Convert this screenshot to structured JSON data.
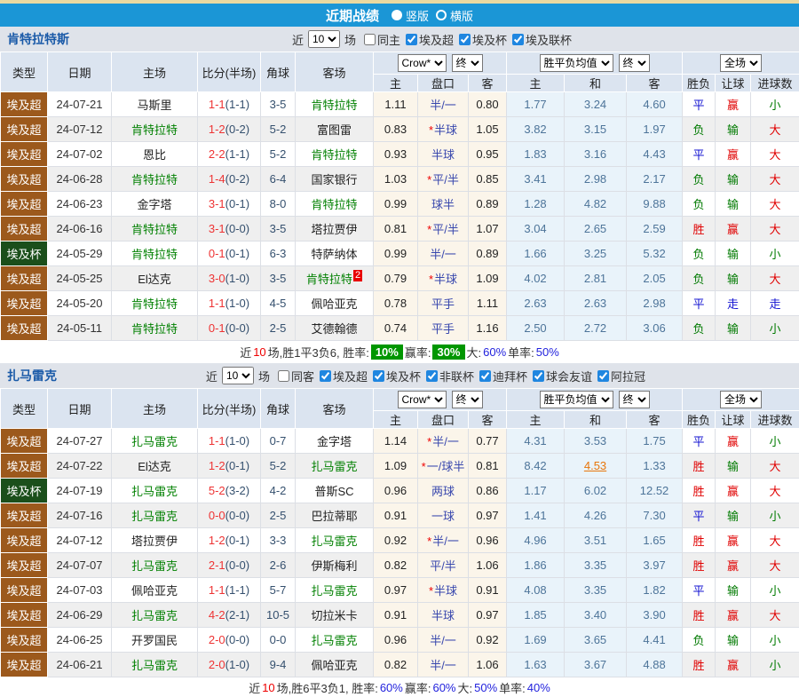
{
  "top_bar": {
    "title": "近期战绩",
    "options": [
      {
        "label": "竖版",
        "selected": true
      },
      {
        "label": "横版",
        "selected": false
      }
    ]
  },
  "columns": {
    "type": "类型",
    "date": "日期",
    "home": "主场",
    "score": "比分(半场)",
    "corner": "角球",
    "away": "客场",
    "h": "主",
    "handicap": "盘口",
    "a": "客",
    "avg_h": "主",
    "avg_d": "和",
    "avg_a": "客",
    "result": "胜负",
    "let_ball": "让球",
    "goals": "进球数"
  },
  "selectors": {
    "bookmaker": "Crow*",
    "time1": "终",
    "avg": "胜平负均值",
    "time2": "终",
    "scope": "全场"
  },
  "type_colors": {
    "埃及超": "#9c591c",
    "埃及杯": "#1b4f1b"
  },
  "value_colors": {
    "胜": "#e00000",
    "平": "#1414d2",
    "负": "#007a00",
    "赢": "#e00000",
    "走": "#1414d2",
    "输": "#007a00",
    "大": "#e00000",
    "小": "#007a00"
  },
  "sections": [
    {
      "team": "肯特拉特斯",
      "filter": {
        "recent": "近",
        "count": "10",
        "unit": "场",
        "venue": {
          "label": "同主",
          "checked": false
        },
        "competitions": [
          {
            "label": "埃及超",
            "checked": true
          },
          {
            "label": "埃及杯",
            "checked": true
          },
          {
            "label": "埃及联杯",
            "checked": true
          }
        ]
      },
      "rows": [
        {
          "type": "埃及超",
          "date": "24-07-21",
          "home": "马斯里",
          "home_green": false,
          "score": "1-1",
          "half": "(1-1)",
          "corner": "3-5",
          "away": "肯特拉特",
          "away_green": true,
          "h": "1.11",
          "star": false,
          "hcp": "半/一",
          "a": "0.80",
          "avg_h": "1.77",
          "avg_d": "3.24",
          "avg_a": "4.60",
          "res": "平",
          "hcp_res": "赢",
          "goal": "小"
        },
        {
          "type": "埃及超",
          "date": "24-07-12",
          "home": "肯特拉特",
          "home_green": true,
          "score": "1-2",
          "half": "(0-2)",
          "corner": "5-2",
          "away": "富图雷",
          "away_green": false,
          "h": "0.83",
          "star": true,
          "hcp": "半球",
          "a": "1.05",
          "avg_h": "3.82",
          "avg_d": "3.15",
          "avg_a": "1.97",
          "res": "负",
          "hcp_res": "输",
          "goal": "大"
        },
        {
          "type": "埃及超",
          "date": "24-07-02",
          "home": "恩比",
          "home_green": false,
          "score": "2-2",
          "half": "(1-1)",
          "corner": "5-2",
          "away": "肯特拉特",
          "away_green": true,
          "h": "0.93",
          "star": false,
          "hcp": "半球",
          "a": "0.95",
          "avg_h": "1.83",
          "avg_d": "3.16",
          "avg_a": "4.43",
          "res": "平",
          "hcp_res": "赢",
          "goal": "大"
        },
        {
          "type": "埃及超",
          "date": "24-06-28",
          "home": "肯特拉特",
          "home_green": true,
          "score": "1-4",
          "half": "(0-2)",
          "corner": "6-4",
          "away": "国家银行",
          "away_green": false,
          "h": "1.03",
          "star": true,
          "hcp": "平/半",
          "a": "0.85",
          "avg_h": "3.41",
          "avg_d": "2.98",
          "avg_a": "2.17",
          "res": "负",
          "hcp_res": "输",
          "goal": "大"
        },
        {
          "type": "埃及超",
          "date": "24-06-23",
          "home": "金字塔",
          "home_green": false,
          "score": "3-1",
          "half": "(0-1)",
          "corner": "8-0",
          "away": "肯特拉特",
          "away_green": true,
          "h": "0.99",
          "star": false,
          "hcp": "球半",
          "a": "0.89",
          "avg_h": "1.28",
          "avg_d": "4.82",
          "avg_a": "9.88",
          "res": "负",
          "hcp_res": "输",
          "goal": "大"
        },
        {
          "type": "埃及超",
          "date": "24-06-16",
          "home": "肯特拉特",
          "home_green": true,
          "score": "3-1",
          "half": "(0-0)",
          "corner": "3-5",
          "away": "塔拉贾伊",
          "away_green": false,
          "h": "0.81",
          "star": true,
          "hcp": "平/半",
          "a": "1.07",
          "avg_h": "3.04",
          "avg_d": "2.65",
          "avg_a": "2.59",
          "res": "胜",
          "hcp_res": "赢",
          "goal": "大"
        },
        {
          "type": "埃及杯",
          "date": "24-05-29",
          "home": "肯特拉特",
          "home_green": true,
          "score": "0-1",
          "half": "(0-1)",
          "corner": "6-3",
          "away": "特萨纳体",
          "away_green": false,
          "h": "0.99",
          "star": false,
          "hcp": "半/一",
          "a": "0.89",
          "avg_h": "1.66",
          "avg_d": "3.25",
          "avg_a": "5.32",
          "res": "负",
          "hcp_res": "输",
          "goal": "小"
        },
        {
          "type": "埃及超",
          "date": "24-05-25",
          "home": "El达克",
          "home_green": false,
          "score": "3-0",
          "half": "(1-0)",
          "corner": "3-5",
          "away": "肯特拉特",
          "away_green": true,
          "badge": "2",
          "h": "0.79",
          "star": true,
          "hcp": "半球",
          "a": "1.09",
          "avg_h": "4.02",
          "avg_d": "2.81",
          "avg_a": "2.05",
          "res": "负",
          "hcp_res": "输",
          "goal": "大"
        },
        {
          "type": "埃及超",
          "date": "24-05-20",
          "home": "肯特拉特",
          "home_green": true,
          "score": "1-1",
          "half": "(1-0)",
          "corner": "4-5",
          "away": "佩哈亚克",
          "away_green": false,
          "h": "0.78",
          "star": false,
          "hcp": "平手",
          "a": "1.11",
          "avg_h": "2.63",
          "avg_d": "2.63",
          "avg_a": "2.98",
          "res": "平",
          "hcp_res": "走",
          "goal": "走"
        },
        {
          "type": "埃及超",
          "date": "24-05-11",
          "home": "肯特拉特",
          "home_green": true,
          "score": "0-1",
          "half": "(0-0)",
          "corner": "2-5",
          "away": "艾德翰德",
          "away_green": false,
          "h": "0.74",
          "star": false,
          "hcp": "平手",
          "a": "1.16",
          "avg_h": "2.50",
          "avg_d": "2.72",
          "avg_a": "3.06",
          "res": "负",
          "hcp_res": "输",
          "goal": "小"
        }
      ],
      "summary": [
        {
          "text": "近"
        },
        {
          "text": "10",
          "color": "red"
        },
        {
          "text": "场,胜1平3负6, 胜率: "
        },
        {
          "text": "10%",
          "badge": true
        },
        {
          "text": " 赢率: "
        },
        {
          "text": "30%",
          "badge": true
        },
        {
          "text": " 大:"
        },
        {
          "text": "60%",
          "color": "blue"
        },
        {
          "text": " 单率:"
        },
        {
          "text": "50%",
          "color": "blue"
        }
      ]
    },
    {
      "team": "扎马雷克",
      "filter": {
        "recent": "近",
        "count": "10",
        "unit": "场",
        "venue": {
          "label": "同客",
          "checked": false
        },
        "competitions": [
          {
            "label": "埃及超",
            "checked": true
          },
          {
            "label": "埃及杯",
            "checked": true
          },
          {
            "label": "非联杯",
            "checked": true
          },
          {
            "label": "迪拜杯",
            "checked": true
          },
          {
            "label": "球会友谊",
            "checked": true
          },
          {
            "label": "阿拉冠",
            "checked": true
          }
        ]
      },
      "rows": [
        {
          "type": "埃及超",
          "date": "24-07-27",
          "home": "扎马雷克",
          "home_green": true,
          "score": "1-1",
          "half": "(1-0)",
          "corner": "0-7",
          "away": "金字塔",
          "away_green": false,
          "h": "1.14",
          "star": true,
          "hcp": "半/一",
          "a": "0.77",
          "avg_h": "4.31",
          "avg_d": "3.53",
          "avg_a": "1.75",
          "res": "平",
          "hcp_res": "赢",
          "goal": "小"
        },
        {
          "type": "埃及超",
          "date": "24-07-22",
          "home": "El达克",
          "home_green": false,
          "score": "1-2",
          "half": "(0-1)",
          "corner": "5-2",
          "away": "扎马雷克",
          "away_green": true,
          "h": "1.09",
          "star": true,
          "hcp": "一/球半",
          "a": "0.81",
          "avg_h": "8.42",
          "avg_d": "4.53",
          "avg_d_hl": true,
          "avg_a": "1.33",
          "res": "胜",
          "hcp_res": "输",
          "goal": "大"
        },
        {
          "type": "埃及杯",
          "date": "24-07-19",
          "home": "扎马雷克",
          "home_green": true,
          "score": "5-2",
          "half": "(3-2)",
          "corner": "4-2",
          "away": "普斯SC",
          "away_green": false,
          "h": "0.96",
          "star": false,
          "hcp": "两球",
          "a": "0.86",
          "avg_h": "1.17",
          "avg_d": "6.02",
          "avg_a": "12.52",
          "res": "胜",
          "hcp_res": "赢",
          "goal": "大"
        },
        {
          "type": "埃及超",
          "date": "24-07-16",
          "home": "扎马雷克",
          "home_green": true,
          "score": "0-0",
          "half": "(0-0)",
          "corner": "2-5",
          "away": "巴拉蒂耶",
          "away_green": false,
          "h": "0.91",
          "star": false,
          "hcp": "一球",
          "a": "0.97",
          "avg_h": "1.41",
          "avg_d": "4.26",
          "avg_a": "7.30",
          "res": "平",
          "hcp_res": "输",
          "goal": "小"
        },
        {
          "type": "埃及超",
          "date": "24-07-12",
          "home": "塔拉贾伊",
          "home_green": false,
          "score": "1-2",
          "half": "(0-1)",
          "corner": "3-3",
          "away": "扎马雷克",
          "away_green": true,
          "h": "0.92",
          "star": true,
          "hcp": "半/一",
          "a": "0.96",
          "avg_h": "4.96",
          "avg_d": "3.51",
          "avg_a": "1.65",
          "res": "胜",
          "hcp_res": "赢",
          "goal": "大"
        },
        {
          "type": "埃及超",
          "date": "24-07-07",
          "home": "扎马雷克",
          "home_green": true,
          "score": "2-1",
          "half": "(0-0)",
          "corner": "2-6",
          "away": "伊斯梅利",
          "away_green": false,
          "h": "0.82",
          "star": false,
          "hcp": "平/半",
          "a": "1.06",
          "avg_h": "1.86",
          "avg_d": "3.35",
          "avg_a": "3.97",
          "res": "胜",
          "hcp_res": "赢",
          "goal": "大"
        },
        {
          "type": "埃及超",
          "date": "24-07-03",
          "home": "佩哈亚克",
          "home_green": false,
          "score": "1-1",
          "half": "(1-1)",
          "corner": "5-7",
          "away": "扎马雷克",
          "away_green": true,
          "h": "0.97",
          "star": true,
          "hcp": "半球",
          "a": "0.91",
          "avg_h": "4.08",
          "avg_d": "3.35",
          "avg_a": "1.82",
          "res": "平",
          "hcp_res": "输",
          "goal": "小"
        },
        {
          "type": "埃及超",
          "date": "24-06-29",
          "home": "扎马雷克",
          "home_green": true,
          "score": "4-2",
          "half": "(2-1)",
          "corner": "10-5",
          "away": "切拉米卡",
          "away_green": false,
          "h": "0.91",
          "star": false,
          "hcp": "半球",
          "a": "0.97",
          "avg_h": "1.85",
          "avg_d": "3.40",
          "avg_a": "3.90",
          "res": "胜",
          "hcp_res": "赢",
          "goal": "大"
        },
        {
          "type": "埃及超",
          "date": "24-06-25",
          "home": "开罗国民",
          "home_green": false,
          "score": "2-0",
          "half": "(0-0)",
          "corner": "0-0",
          "away": "扎马雷克",
          "away_green": true,
          "h": "0.96",
          "star": false,
          "hcp": "半/一",
          "a": "0.92",
          "avg_h": "1.69",
          "avg_d": "3.65",
          "avg_a": "4.41",
          "res": "负",
          "hcp_res": "输",
          "goal": "小"
        },
        {
          "type": "埃及超",
          "date": "24-06-21",
          "home": "扎马雷克",
          "home_green": true,
          "score": "2-0",
          "half": "(1-0)",
          "corner": "9-4",
          "away": "佩哈亚克",
          "away_green": false,
          "h": "0.82",
          "star": false,
          "hcp": "半/一",
          "a": "1.06",
          "avg_h": "1.63",
          "avg_d": "3.67",
          "avg_a": "4.88",
          "res": "胜",
          "hcp_res": "赢",
          "goal": "小"
        }
      ],
      "summary": [
        {
          "text": "近"
        },
        {
          "text": "10",
          "color": "red"
        },
        {
          "text": "场,胜6平3负1, 胜率:"
        },
        {
          "text": "60%",
          "color": "blue"
        },
        {
          "text": " 赢率:"
        },
        {
          "text": "60%",
          "color": "blue"
        },
        {
          "text": " 大:"
        },
        {
          "text": "50%",
          "color": "blue"
        },
        {
          "text": " 单率:"
        },
        {
          "text": "40%",
          "color": "blue"
        }
      ]
    }
  ]
}
